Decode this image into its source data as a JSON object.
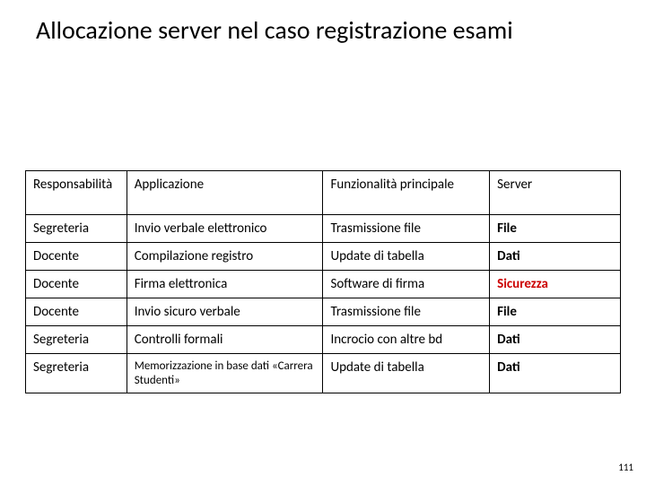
{
  "title": "Allocazione server nel caso registrazione esami",
  "headers": {
    "responsabilita": "Responsabilità",
    "applicazione": "Applicazione",
    "funzionalita": "Funzionalità principale",
    "server": "Server"
  },
  "rows": [
    {
      "responsabilita": "Segreteria",
      "applicazione": "Invio verbale elettronico",
      "funzionalita": "Trasmissione file",
      "server": "File",
      "smallApp": false,
      "serverEmph": ""
    },
    {
      "responsabilita": "Docente",
      "applicazione": "Compilazione registro",
      "funzionalita": "Update di tabella",
      "server": "Dati",
      "smallApp": false,
      "serverEmph": ""
    },
    {
      "responsabilita": "Docente",
      "applicazione": "Firma elettronica",
      "funzionalita": "Software di firma",
      "server": "Sicurezza",
      "smallApp": false,
      "serverEmph": "sicurezza"
    },
    {
      "responsabilita": "Docente",
      "applicazione": "Invio sicuro verbale",
      "funzionalita": "Trasmissione file",
      "server": "File",
      "smallApp": false,
      "serverEmph": ""
    },
    {
      "responsabilita": "Segreteria",
      "applicazione": "Controlli formali",
      "funzionalita": "Incrocio con altre bd",
      "server": "Dati",
      "smallApp": false,
      "serverEmph": ""
    },
    {
      "responsabilita": "Segreteria",
      "applicazione": "Memorizzazione in base dati «Carrera Studenti»",
      "funzionalita": "Update di tabella",
      "server": "Dati",
      "smallApp": true,
      "serverEmph": ""
    }
  ],
  "page_number": "111"
}
